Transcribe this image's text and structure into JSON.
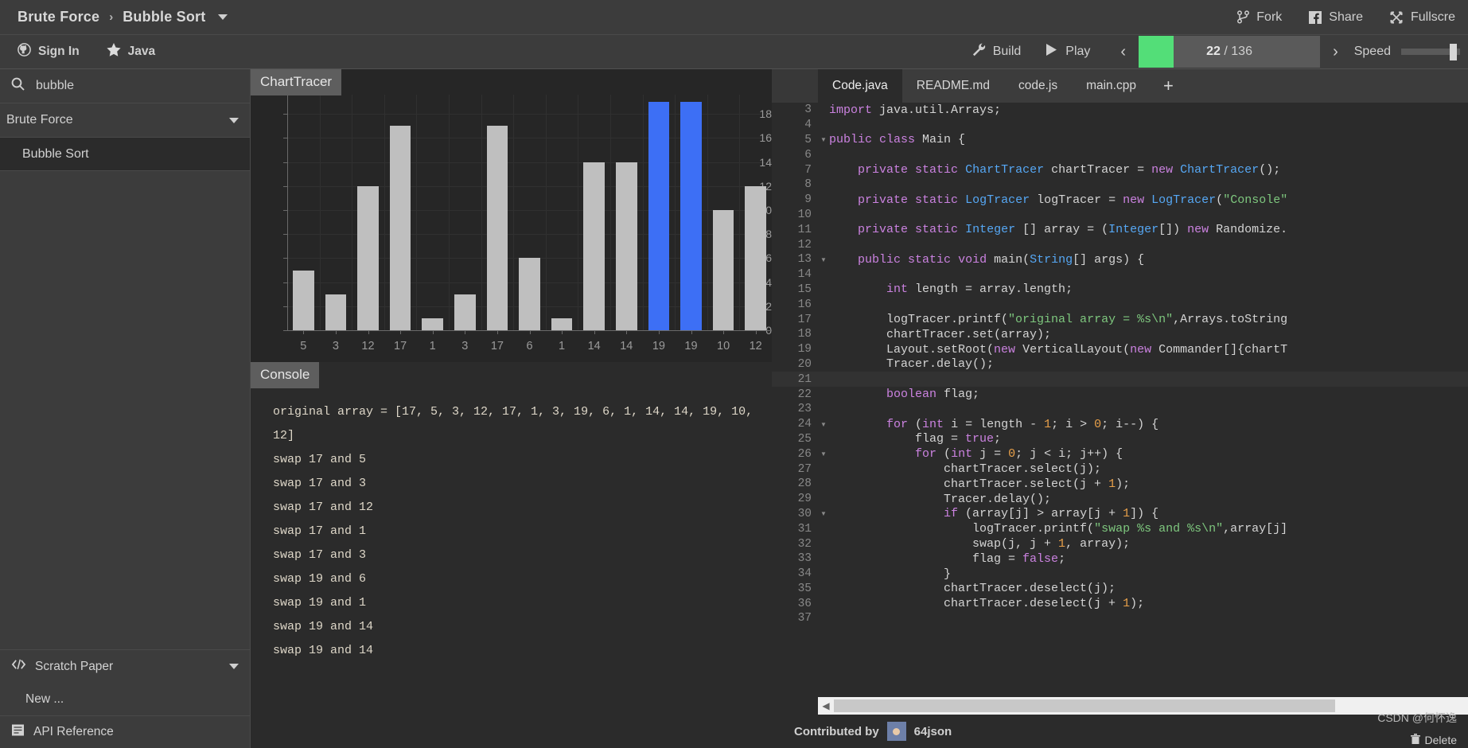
{
  "topbar": {
    "breadcrumb": [
      "Brute Force",
      "Bubble Sort"
    ],
    "separator": "›",
    "fork": "Fork",
    "share": "Share",
    "fullscreen": "Fullscre"
  },
  "secondbar": {
    "sign_in": "Sign In",
    "language": "Java",
    "build": "Build",
    "play": "Play",
    "step_current": "22",
    "step_sep": "/",
    "step_total": "136",
    "step_display": "22 / 136",
    "speed": "Speed",
    "accent_green": "#53de78"
  },
  "sidebar": {
    "search_value": "bubble",
    "category": "Brute Force",
    "algorithm": "Bubble Sort",
    "scratch_paper": "Scratch Paper",
    "new_item": "New ...",
    "api_reference": "API Reference"
  },
  "viz": {
    "chart_title": "ChartTracer",
    "console_title": "Console",
    "console_lines": [
      "original array = [17, 5, 3, 12, 17, 1, 3, 19, 6, 1, 14, 14, 19, 10,",
      "12]",
      "swap 17 and 5",
      "swap 17 and 3",
      "swap 17 and 12",
      "swap 17 and 1",
      "swap 17 and 3",
      "swap 19 and 6",
      "swap 19 and 1",
      "swap 19 and 14",
      "swap 19 and 14"
    ]
  },
  "chart_data": {
    "type": "bar",
    "title": "ChartTracer",
    "xlabel": "",
    "ylabel": "",
    "categories": [
      "5",
      "3",
      "12",
      "17",
      "1",
      "3",
      "17",
      "6",
      "1",
      "14",
      "14",
      "19",
      "19",
      "10",
      "12"
    ],
    "values": [
      5,
      3,
      12,
      17,
      1,
      3,
      17,
      6,
      1,
      14,
      14,
      19,
      19,
      10,
      12
    ],
    "selected_indices": [
      11,
      12
    ],
    "bar_color": "#bfbfbf",
    "selected_color": "#3d6ff5",
    "ylim": [
      0,
      19
    ],
    "yticks": [
      0,
      2,
      4,
      6,
      8,
      10,
      12,
      14,
      16,
      18
    ],
    "grid": true,
    "legend": "none"
  },
  "editor": {
    "tabs": [
      "Code.java",
      "README.md",
      "code.js",
      "main.cpp"
    ],
    "active_tab": "Code.java",
    "add_tab": "+",
    "highlighted_line": 21,
    "lines": [
      {
        "n": "3",
        "fold": false,
        "text": "import java.util.Arrays;"
      },
      {
        "n": "4",
        "fold": false,
        "text": ""
      },
      {
        "n": "5",
        "fold": true,
        "text": "public class Main {"
      },
      {
        "n": "6",
        "fold": false,
        "text": ""
      },
      {
        "n": "7",
        "fold": false,
        "text": "    private static ChartTracer chartTracer = new ChartTracer();"
      },
      {
        "n": "8",
        "fold": false,
        "text": ""
      },
      {
        "n": "9",
        "fold": false,
        "text": "    private static LogTracer logTracer = new LogTracer(\"Console\""
      },
      {
        "n": "10",
        "fold": false,
        "text": ""
      },
      {
        "n": "11",
        "fold": false,
        "text": "    private static Integer [] array = (Integer[]) new Randomize."
      },
      {
        "n": "12",
        "fold": false,
        "text": ""
      },
      {
        "n": "13",
        "fold": true,
        "text": "    public static void main(String[] args) {"
      },
      {
        "n": "14",
        "fold": false,
        "text": ""
      },
      {
        "n": "15",
        "fold": false,
        "text": "        int length = array.length;"
      },
      {
        "n": "16",
        "fold": false,
        "text": ""
      },
      {
        "n": "17",
        "fold": false,
        "text": "        logTracer.printf(\"original array = %s\\n\",Arrays.toString"
      },
      {
        "n": "18",
        "fold": false,
        "text": "        chartTracer.set(array);"
      },
      {
        "n": "19",
        "fold": false,
        "text": "        Layout.setRoot(new VerticalLayout(new Commander[]{chartT"
      },
      {
        "n": "20",
        "fold": false,
        "text": "        Tracer.delay();"
      },
      {
        "n": "21",
        "fold": false,
        "text": ""
      },
      {
        "n": "22",
        "fold": false,
        "text": "        boolean flag;"
      },
      {
        "n": "23",
        "fold": false,
        "text": ""
      },
      {
        "n": "24",
        "fold": true,
        "text": "        for (int i = length - 1; i > 0; i--) {"
      },
      {
        "n": "25",
        "fold": false,
        "text": "            flag = true;"
      },
      {
        "n": "26",
        "fold": true,
        "text": "            for (int j = 0; j < i; j++) {"
      },
      {
        "n": "27",
        "fold": false,
        "text": "                chartTracer.select(j);"
      },
      {
        "n": "28",
        "fold": false,
        "text": "                chartTracer.select(j + 1);"
      },
      {
        "n": "29",
        "fold": false,
        "text": "                Tracer.delay();"
      },
      {
        "n": "30",
        "fold": true,
        "text": "                if (array[j] > array[j + 1]) {"
      },
      {
        "n": "31",
        "fold": false,
        "text": "                    logTracer.printf(\"swap %s and %s\\n\",array[j]"
      },
      {
        "n": "32",
        "fold": false,
        "text": "                    swap(j, j + 1, array);"
      },
      {
        "n": "33",
        "fold": false,
        "text": "                    flag = false;"
      },
      {
        "n": "34",
        "fold": false,
        "text": "                }"
      },
      {
        "n": "35",
        "fold": false,
        "text": "                chartTracer.deselect(j);"
      },
      {
        "n": "36",
        "fold": false,
        "text": "                chartTracer.deselect(j + 1);"
      },
      {
        "n": "37",
        "fold": false,
        "text": ""
      }
    ],
    "contributed_by": "Contributed by",
    "contributor": "64json",
    "watermark": "CSDN @何怀逸",
    "delete_label": "Delete"
  }
}
